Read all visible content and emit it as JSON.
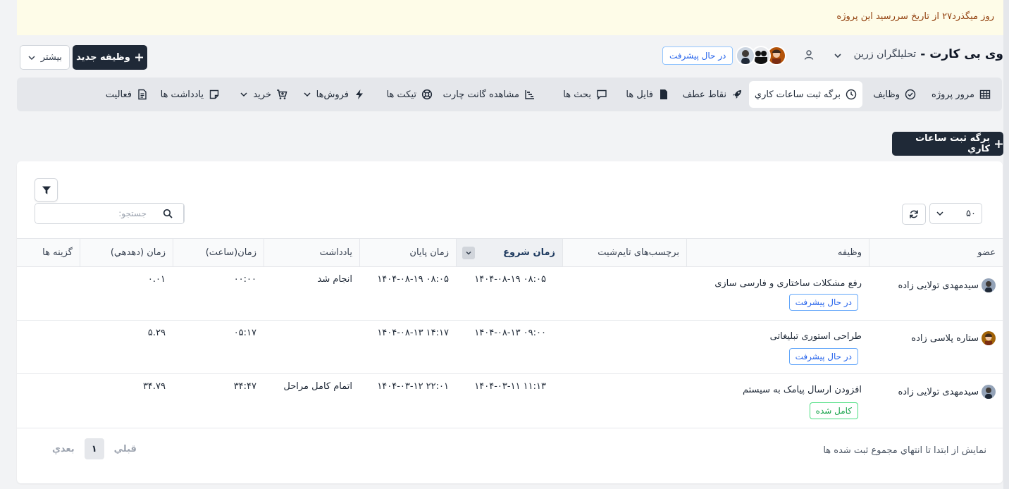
{
  "alert": {
    "text": "روز میگذرد۲۷ از تاریخ سررسید این پروژه"
  },
  "header": {
    "project_name": "وی بی کارت",
    "separator": "-",
    "client_name": "تحلیلگران زرین",
    "status": "در حال پیشرفت",
    "new_task_label": "وظیفه جدید",
    "more_label": "بیشتر"
  },
  "tabs": [
    {
      "label": "مرور پروژه",
      "icon": "grid-icon"
    },
    {
      "label": "وظایف",
      "icon": "check-circle-icon"
    },
    {
      "label": "برگه ثبت ساعات کاري",
      "icon": "clock-icon",
      "active": true
    },
    {
      "label": "نقاط عطف",
      "icon": "rocket-icon"
    },
    {
      "label": "فایل ها",
      "icon": "file-icon"
    },
    {
      "label": "بحث ها",
      "icon": "chat-icon"
    },
    {
      "label": "مشاهده گانت چارت",
      "icon": "gantt-icon"
    },
    {
      "label": "تیکت ها",
      "icon": "lifebuoy-icon"
    },
    {
      "label": "فروش‌ها",
      "icon": "bolt-icon",
      "dropdown": true
    },
    {
      "label": "خرید",
      "icon": "cart-icon",
      "dropdown": true
    },
    {
      "label": "یادداشت ها",
      "icon": "note-icon"
    },
    {
      "label": "فعالیت",
      "icon": "document-icon"
    }
  ],
  "actions": {
    "add_timesheet_label": "برگه ثبت ساعات کاري"
  },
  "table_controls": {
    "page_size": "۵۰",
    "search_placeholder": "جستجو:"
  },
  "table": {
    "headers": [
      "عضو",
      "وظیفه",
      "برچسب‌های تایم‌شیت",
      "زمان شروع",
      "زمان پایان",
      "یادداشت",
      "زمان(ساعت)",
      "زمان (دهدهي)",
      "گزینه ها"
    ],
    "sorted_column": "زمان شروع",
    "rows": [
      {
        "member": "سیدمهدی تولایی زاده",
        "task": "رفع مشکلات ساختاری و فارسی سازی",
        "task_status": "در حال پیشرفت",
        "tags": "",
        "start": "۱۴۰۴-۰۸-۱۹ ۰۸:۰۵",
        "end": "۱۴۰۴-۰۸-۱۹ ۰۸:۰۵",
        "note": "انجام شد",
        "hours": "۰۰:۰۰",
        "decimal": "۰.۰۱"
      },
      {
        "member": "ستاره پلاسی زاده",
        "task": "طراحی استوری تبلیغاتی",
        "task_status": "در حال پیشرفت",
        "tags": "",
        "start": "۱۴۰۴-۰۸-۱۳ ۰۹:۰۰",
        "end": "۱۴۰۴-۰۸-۱۳ ۱۴:۱۷",
        "note": "",
        "hours": "۰۵:۱۷",
        "decimal": "۵.۲۹"
      },
      {
        "member": "سیدمهدی تولایی زاده",
        "task": "افزودن ارسال پیامک به سیستم",
        "task_status": "کامل شده",
        "tags": "",
        "start": "۱۴۰۴-۰۳-۱۱ ۱۱:۱۳",
        "end": "۱۴۰۴-۰۳-۱۲ ۲۲:۰۱",
        "note": "اتمام کامل مراحل",
        "hours": "۳۴:۴۷",
        "decimal": "۳۴.۷۹"
      }
    ]
  },
  "footer": {
    "info": "نمایش از ابتدا تا انتهاي مجموع ثبت شده ها",
    "prev_label": "قبلي",
    "next_label": "بعدي",
    "current_page": "۱"
  },
  "colors": {
    "dark_button": "#1f2937",
    "in_progress": "#2563eb",
    "completed": "#16a34a",
    "alert_bg": "#fefce8",
    "alert_text": "#92400e"
  }
}
